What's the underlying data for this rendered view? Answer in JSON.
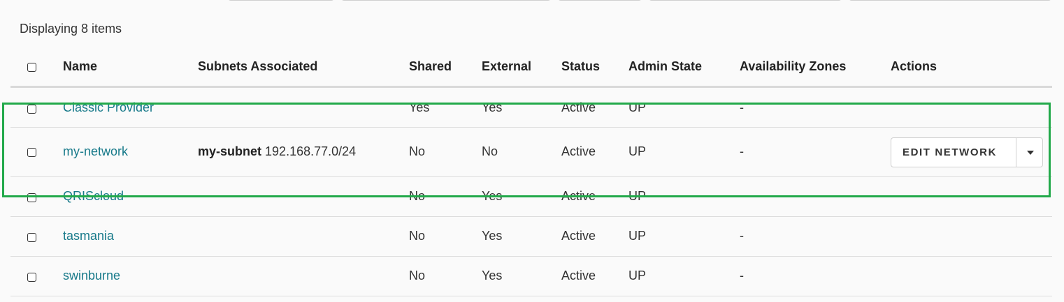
{
  "table": {
    "count_text": "Displaying 8 items",
    "headers": {
      "name": "Name",
      "subnets": "Subnets Associated",
      "shared": "Shared",
      "external": "External",
      "status": "Status",
      "admin_state": "Admin State",
      "zones": "Availability Zones",
      "actions": "Actions"
    },
    "rows": [
      {
        "name": "Classic Provider",
        "subnet_name": "",
        "subnet_cidr": "",
        "shared": "Yes",
        "external": "Yes",
        "status": "Active",
        "admin_state": "UP",
        "zones": "-"
      },
      {
        "name": "my-network",
        "subnet_name": "my-subnet",
        "subnet_cidr": "192.168.77.0/24",
        "shared": "No",
        "external": "No",
        "status": "Active",
        "admin_state": "UP",
        "zones": "-",
        "action_label": "EDIT NETWORK"
      },
      {
        "name": "QRIScloud",
        "subnet_name": "",
        "subnet_cidr": "",
        "shared": "No",
        "external": "Yes",
        "status": "Active",
        "admin_state": "UP",
        "zones": ""
      },
      {
        "name": "tasmania",
        "subnet_name": "",
        "subnet_cidr": "",
        "shared": "No",
        "external": "Yes",
        "status": "Active",
        "admin_state": "UP",
        "zones": "-"
      },
      {
        "name": "swinburne",
        "subnet_name": "",
        "subnet_cidr": "",
        "shared": "No",
        "external": "Yes",
        "status": "Active",
        "admin_state": "UP",
        "zones": "-"
      }
    ]
  },
  "colors": {
    "link": "#187a8a",
    "highlight": "#22a94a"
  }
}
